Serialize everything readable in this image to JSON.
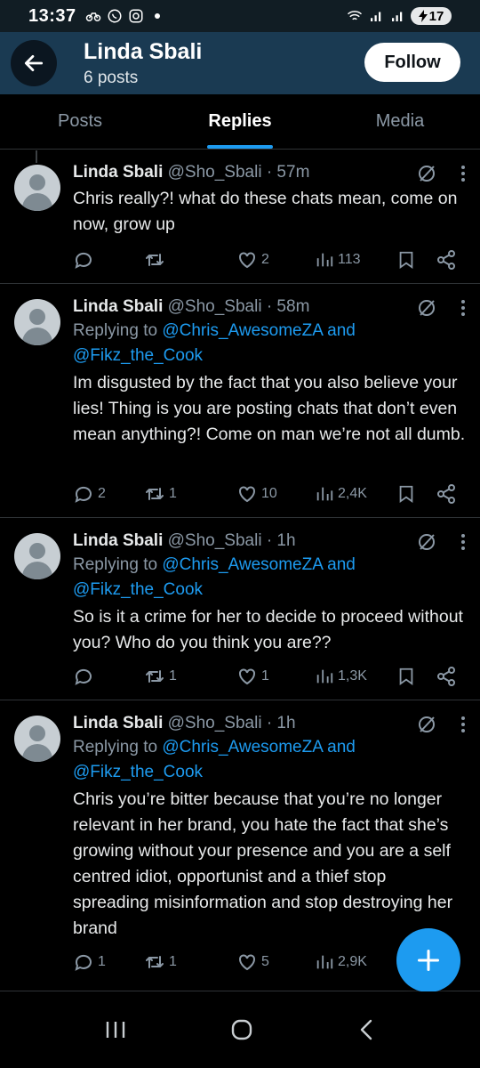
{
  "status_bar": {
    "time": "13:37",
    "battery": "17",
    "icons": [
      "bike-icon",
      "whatsapp-icon",
      "instagram-icon",
      "dot-icon",
      "wifi-icon",
      "signal-icon",
      "signal-icon",
      "battery-icon"
    ]
  },
  "header": {
    "name": "Linda Sbali",
    "posts": "6 posts",
    "follow_label": "Follow"
  },
  "tabs": [
    {
      "label": "Posts",
      "active": false
    },
    {
      "label": "Replies",
      "active": true
    },
    {
      "label": "Media",
      "active": false
    }
  ],
  "tweets": [
    {
      "name": "Linda Sbali",
      "handle": "@Sho_Sbali · 57m",
      "replying_prefix": "",
      "mention1": "",
      "and_word": "",
      "mention2": "",
      "text": "Chris really?! what do these chats mean, come on now, grow up",
      "replies": "",
      "retweets": "",
      "likes": "2",
      "views": "113"
    },
    {
      "name": "Linda Sbali",
      "handle": "@Sho_Sbali · 58m",
      "replying_prefix": "Replying to ",
      "mention1": "@Chris_AwesomeZA",
      "and_word": " and",
      "mention2": "@Fikz_the_Cook",
      "text": "Im disgusted by the fact that you also believe your lies! Thing is you are posting chats that don’t even mean anything?! Come on man we’re not all dumb.",
      "replies": "2",
      "retweets": "1",
      "likes": "10",
      "views": "2,4K"
    },
    {
      "name": "Linda Sbali",
      "handle": "@Sho_Sbali · 1h",
      "replying_prefix": "Replying to ",
      "mention1": "@Chris_AwesomeZA",
      "and_word": " and",
      "mention2": "@Fikz_the_Cook",
      "text": "So is it a crime for her to decide to proceed without you? Who do you think you are??",
      "replies": "",
      "retweets": "1",
      "likes": "1",
      "views": "1,3K"
    },
    {
      "name": "Linda Sbali",
      "handle": "@Sho_Sbali · 1h",
      "replying_prefix": "Replying to ",
      "mention1": "@Chris_AwesomeZA",
      "and_word": " and",
      "mention2": "@Fikz_the_Cook",
      "text": "Chris you’re bitter because that you’re no longer relevant in her brand, you hate the fact that she’s growing without your presence and you are a self centred idiot, opportunist and a thief stop spreading misinformation and stop destroying her brand",
      "replies": "1",
      "retweets": "1",
      "likes": "5",
      "views": "2,9K"
    }
  ],
  "colors": {
    "accent": "#1d9bf0",
    "header_bg": "#1a3a52",
    "text_muted": "#8b98a5"
  }
}
